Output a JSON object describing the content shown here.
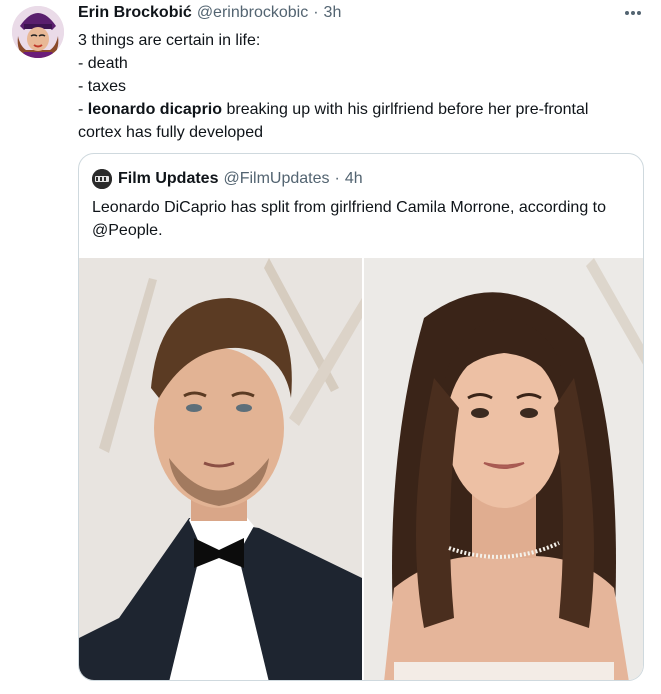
{
  "tweet": {
    "author_name": "Erin Brockobić",
    "author_handle": "@erinbrockobic",
    "separator": "·",
    "time": "3h",
    "lines": [
      "3 things are certain in life:",
      "- death",
      "- taxes"
    ],
    "line4_prefix": "- ",
    "line4_bold": "leonardo dicaprio",
    "line4_rest": " breaking up with his girlfriend before her pre-frontal",
    "line5": "cortex has fully developed"
  },
  "quoted_tweet": {
    "author_name": "Film Updates",
    "author_handle": "@FilmUpdates",
    "separator": "·",
    "time": "4h",
    "text": "Leonardo DiCaprio has split from girlfriend Camila Morrone, according to @People."
  },
  "icons": {
    "more": "more-horizontal-icon",
    "avatar": "avatar-image",
    "quoted_avatar": "film-updates-logo"
  }
}
